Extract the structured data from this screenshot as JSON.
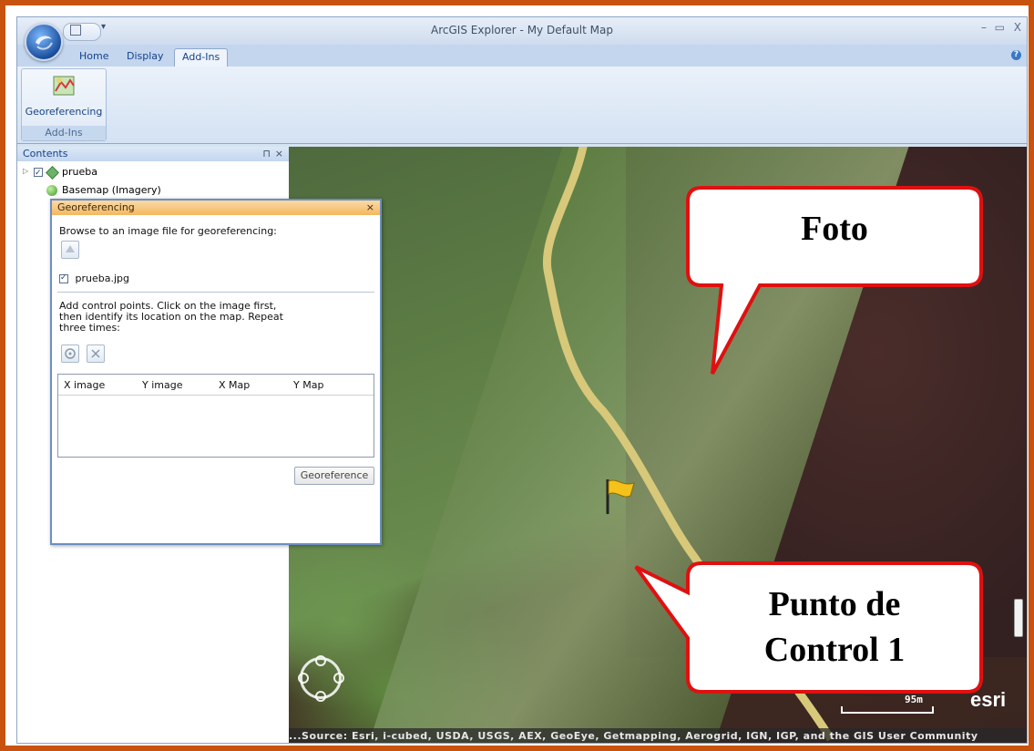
{
  "window": {
    "title": "ArcGIS Explorer - My Default Map",
    "minimize": "–",
    "restore": "▭",
    "close": "X"
  },
  "ribbon": {
    "tabs": [
      {
        "label": "Home"
      },
      {
        "label": "Display"
      },
      {
        "label": "Add-Ins"
      }
    ],
    "group": {
      "button_label": "Georeferencing",
      "group_label": "Add-Ins"
    },
    "help": "?"
  },
  "contents": {
    "title": "Contents",
    "pin": "ᵖ",
    "close": "×",
    "layers": [
      {
        "label": "prueba"
      },
      {
        "label": "Basemap (Imagery)"
      }
    ]
  },
  "georef_panel": {
    "title": "Georeferencing",
    "close": "×",
    "browse_text": "Browse to an image file for georeferencing:",
    "image_file": "prueba.jpg",
    "instructions": [
      "Add control points. Click on the image first,",
      "then identify its location on the map. Repeat",
      "three times:"
    ],
    "columns": [
      "X image",
      "Y image",
      "X Map",
      "Y Map"
    ],
    "button": "Georeference"
  },
  "map": {
    "scale_label": "95m",
    "logo": "esri",
    "attribution": "...Source: Esri, i-cubed, USDA, USGS, AEX, GeoEye, Getmapping, Aerogrid, IGN, IGP, and the GIS User Community"
  },
  "callouts": {
    "top": "Foto",
    "bottom_line1": "Punto de",
    "bottom_line2": "Control 1"
  },
  "colors": {
    "frame": "#c8530e",
    "callout_border": "#e01010",
    "ribbon_text": "#15428b"
  }
}
